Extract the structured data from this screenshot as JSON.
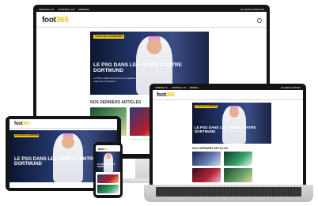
{
  "desktop": {
    "topbar": {
      "items": [
        "ARSENAL FC",
        "FOOTBALL FR",
        "MONDIAL"
      ],
      "right": "ALLIANCE CODE MA"
    },
    "logo_text": "foot",
    "logo_mark": "365",
    "hero_tag": "LIGUE DES CHAMPIONS",
    "hero_title": "LE PSG DANS LES TEMPS CONTRE DORTMUND",
    "hero_sub": "Le PSG a battu Dortmund et se qualifie en quarts de finale de la Ligue des champions",
    "section_title": "NOS DERNIERS ARTICLES"
  },
  "laptop": {
    "topbar": {
      "items": [
        "ARSENAL FC",
        "FOOTBALL FR",
        "MONDIAL"
      ],
      "right": "ALLIANCE CODE MA"
    },
    "logo_text": "foot",
    "logo_mark": "365",
    "hero_tag": "LIGUE DES CHAMPIONS",
    "hero_title": "LE PSG DANS LES TEMPS CONTRE DORTMUND",
    "section_title": "NOS DERNIERS ARTICLES"
  },
  "tablet": {
    "logo_text": "foot",
    "logo_mark": "365",
    "hero_tag": "LIGUE DES CHAMPIONS",
    "hero_title": "LE PSG DANS LES TEMPS CONTRE DORTMUND"
  },
  "phone": {
    "logo_text": "foot",
    "logo_mark": "365",
    "hero_title": "LE PSG DANS LES TEMPS"
  },
  "colors": {
    "accent": "#f0c417",
    "dark": "#161616",
    "hero": "#263a73"
  }
}
